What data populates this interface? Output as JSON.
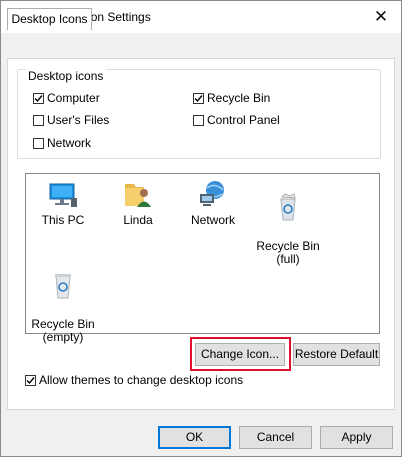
{
  "window": {
    "title": "Desktop Icon Settings",
    "close_glyph": "✕"
  },
  "tabs": [
    {
      "label": "Desktop Icons",
      "selected": true
    }
  ],
  "desktop_icons_group": {
    "legend": "Desktop icons",
    "checkboxes": [
      {
        "label": "Computer",
        "checked": true
      },
      {
        "label": "Recycle Bin",
        "checked": true
      },
      {
        "label": "User's Files",
        "checked": false
      },
      {
        "label": "Control Panel",
        "checked": false
      },
      {
        "label": "Network",
        "checked": false
      }
    ]
  },
  "icon_list": [
    {
      "label": "This PC",
      "icon": "computer-icon",
      "selected": false
    },
    {
      "label": "Linda",
      "icon": "user-folder-icon",
      "selected": false
    },
    {
      "label": "Network",
      "icon": "network-icon",
      "selected": false
    },
    {
      "label": "Recycle Bin\n(full)",
      "icon": "recycle-bin-full-icon",
      "selected": false
    },
    {
      "label": "Recycle Bin\n(empty)",
      "icon": "recycle-bin-empty-icon",
      "selected": false
    }
  ],
  "buttons": {
    "change_icon": "Change Icon...",
    "restore_default": "Restore Default",
    "ok": "OK",
    "cancel": "Cancel",
    "apply": "Apply"
  },
  "allow_themes": {
    "label": "Allow themes to change desktop icons",
    "checked": true
  },
  "colors": {
    "highlight": "#e0102a",
    "accent": "#0078d7",
    "face": "#f0f0f0"
  }
}
